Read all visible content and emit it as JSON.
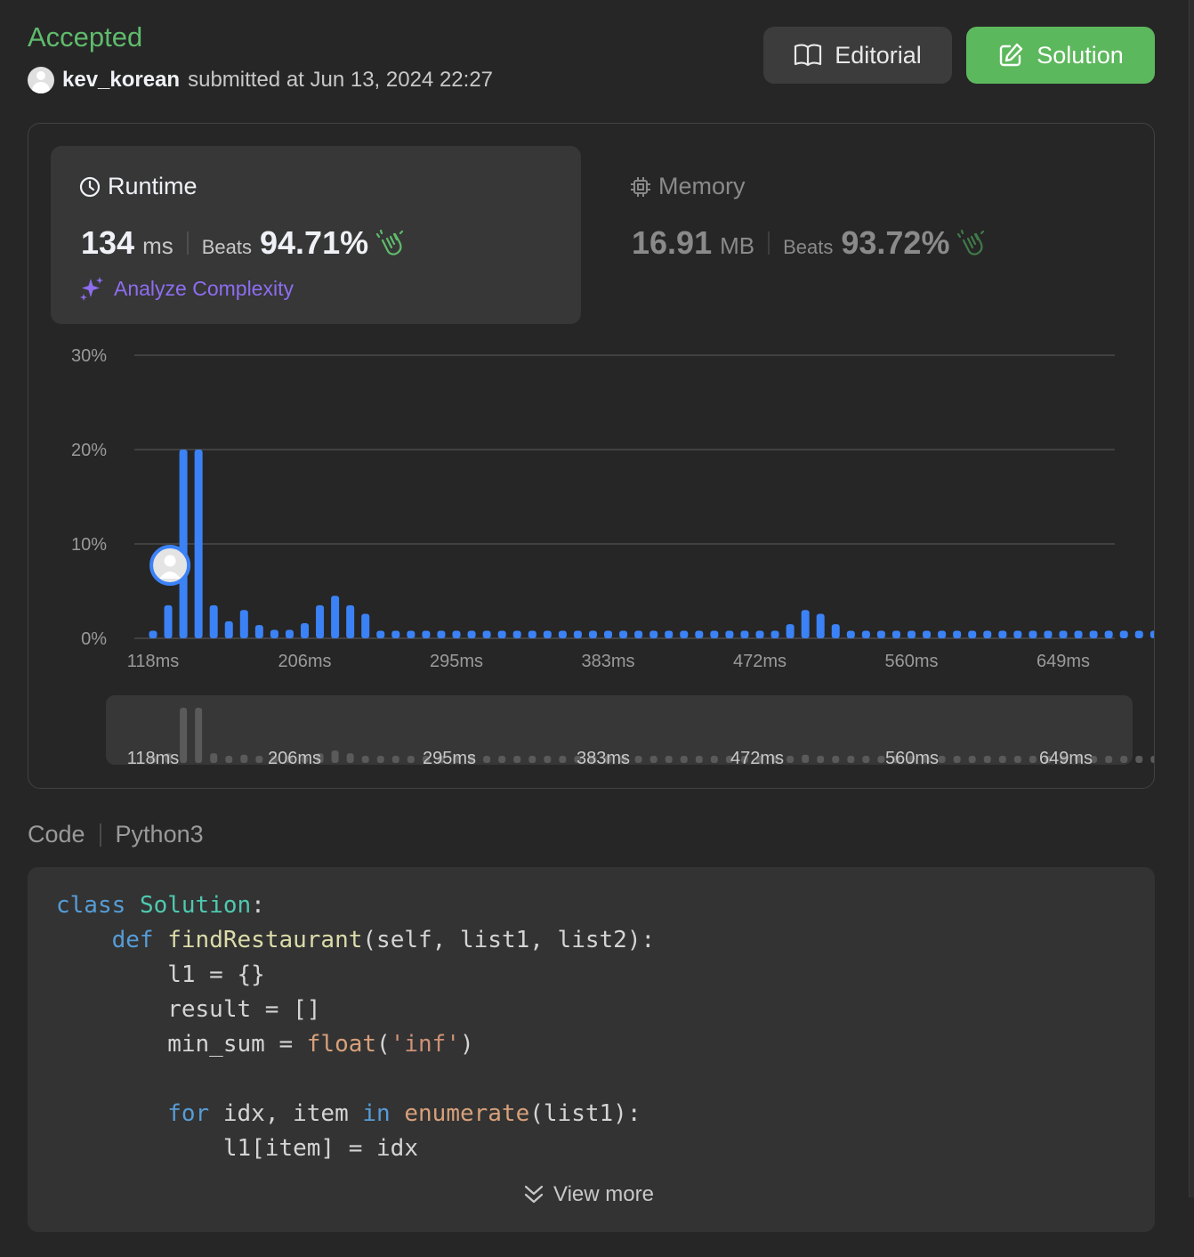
{
  "header": {
    "status": "Accepted",
    "username": "kev_korean",
    "submitted_text": "submitted at Jun 13, 2024 22:27",
    "editorial_label": "Editorial",
    "solution_label": "Solution"
  },
  "runtime": {
    "title": "Runtime",
    "value": "134",
    "unit": "ms",
    "beats_label": "Beats",
    "beats_pct": "94.71%",
    "analyze_label": "Analyze Complexity"
  },
  "memory": {
    "title": "Memory",
    "value": "16.91",
    "unit": "MB",
    "beats_label": "Beats",
    "beats_pct": "93.72%"
  },
  "colors": {
    "accepted": "#5fbb6c",
    "bar": "#3b82f6",
    "solution_button": "#5cb85c",
    "analyze": "#8d6df0",
    "mini_bar": "#5a5a5a"
  },
  "chart_data": {
    "type": "bar",
    "xlabel": "",
    "ylabel": "",
    "ylim": [
      0,
      30
    ],
    "y_ticks": [
      "30%",
      "20%",
      "10%",
      "0%"
    ],
    "y_tick_values": [
      30,
      20,
      10,
      0
    ],
    "x_tick_labels": [
      "118ms",
      "206ms",
      "295ms",
      "383ms",
      "472ms",
      "560ms",
      "649ms"
    ],
    "user_marker_index": 2,
    "grid": true,
    "values": [
      0.8,
      3.5,
      20,
      20,
      3.5,
      1.8,
      3,
      1.4,
      0.9,
      0.9,
      1.6,
      3.5,
      4.5,
      3.5,
      2.6,
      0.8,
      0.8,
      0.8,
      0.8,
      0.8,
      0.8,
      0.8,
      0.8,
      0.8,
      0.8,
      0.8,
      0.8,
      0.8,
      0.8,
      0.8,
      0.8,
      0.8,
      0.8,
      0.8,
      0.8,
      0.8,
      0.8,
      0.8,
      0.8,
      0.8,
      0.8,
      0.8,
      1.5,
      3,
      2.6,
      1.5,
      0.8,
      0.8,
      0.8,
      0.8,
      0.8,
      0.8,
      0.8,
      0.8,
      0.8,
      0.8,
      0.8,
      0.8,
      0.8,
      0.8,
      0.8,
      0.8,
      0.8,
      0.8,
      0.8,
      0.8,
      0.8
    ]
  },
  "code": {
    "header_label": "Code",
    "language": "Python3",
    "lines": [
      [
        {
          "t": "class",
          "c": "kw"
        },
        {
          "t": " "
        },
        {
          "t": "Solution",
          "c": "cls"
        },
        {
          "t": ":"
        }
      ],
      [
        {
          "t": "    "
        },
        {
          "t": "def",
          "c": "kw"
        },
        {
          "t": " "
        },
        {
          "t": "findRestaurant",
          "c": "fn"
        },
        {
          "t": "(self, list1, list2):"
        }
      ],
      [
        {
          "t": "        l1 = {}"
        }
      ],
      [
        {
          "t": "        result = []"
        }
      ],
      [
        {
          "t": "        min_sum = "
        },
        {
          "t": "float",
          "c": "bi"
        },
        {
          "t": "("
        },
        {
          "t": "'inf'",
          "c": "str"
        },
        {
          "t": ")"
        }
      ],
      [
        {
          "t": ""
        }
      ],
      [
        {
          "t": "        "
        },
        {
          "t": "for",
          "c": "kw"
        },
        {
          "t": " idx, item "
        },
        {
          "t": "in",
          "c": "kw"
        },
        {
          "t": " "
        },
        {
          "t": "enumerate",
          "c": "bi"
        },
        {
          "t": "(list1):"
        }
      ],
      [
        {
          "t": "            l1[item] = idx"
        }
      ]
    ],
    "view_more_label": "View more"
  }
}
